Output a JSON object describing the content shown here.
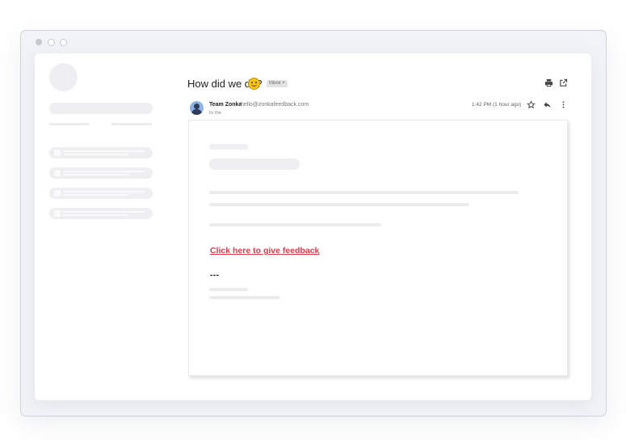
{
  "window": {
    "controls": [
      "close",
      "minimize",
      "maximize"
    ]
  },
  "email": {
    "subject": "How did we do?",
    "subject_emoji": "smiling-face-icon",
    "label_badge": "Inbox ×",
    "sender_name": "Team Zonka",
    "sender_email": "hello@zonkafeedback.com",
    "recipient": "to me",
    "timestamp": "1:42 PM (1 hour ago)",
    "cta_link": "Click here to give feedback",
    "separator": "---"
  },
  "icons": {
    "print": "print-icon",
    "open_new_window": "external-link-icon",
    "star": "star-icon",
    "reply": "reply-icon",
    "more": "more-vert-icon"
  },
  "colors": {
    "link": "#e5394a",
    "placeholder": "#efeff1",
    "frame_border": "#cfd3da"
  }
}
